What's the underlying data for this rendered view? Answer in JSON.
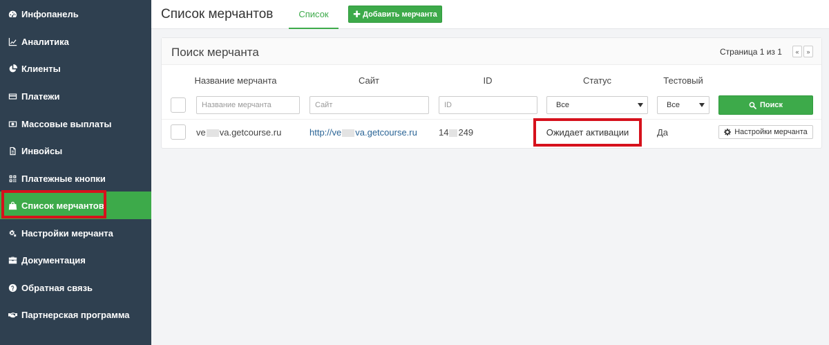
{
  "sidebar": {
    "bg_color": "#2f4050",
    "active_color": "#3daa4a",
    "items": [
      {
        "label": "Инфопанель",
        "icon": "dashboard-icon"
      },
      {
        "label": "Аналитика",
        "icon": "line-chart-icon"
      },
      {
        "label": "Клиенты",
        "icon": "pie-chart-icon"
      },
      {
        "label": "Платежи",
        "icon": "credit-card-icon"
      },
      {
        "label": "Массовые выплаты",
        "icon": "money-icon"
      },
      {
        "label": "Инвойсы",
        "icon": "document-icon"
      },
      {
        "label": "Платежные кнопки",
        "icon": "qrcode-icon"
      },
      {
        "label": "Список мерчантов",
        "icon": "shopping-bag-icon",
        "active": true
      },
      {
        "label": "Настройки мерчанта",
        "icon": "gears-icon"
      },
      {
        "label": "Документация",
        "icon": "briefcase-icon"
      },
      {
        "label": "Обратная связь",
        "icon": "question-circle-icon"
      },
      {
        "label": "Партнерская программа",
        "icon": "handshake-icon"
      }
    ]
  },
  "header": {
    "title": "Список мерчантов",
    "tab_label": "Список",
    "add_button": "Добавить мерчанта"
  },
  "panel": {
    "title": "Поиск мерчанта",
    "pager": {
      "text": "Страница 1 из 1",
      "prev": "«",
      "next": "»"
    }
  },
  "table": {
    "columns": [
      "Название мерчанта",
      "Сайт",
      "ID",
      "Статус",
      "Тестовый"
    ],
    "filters": {
      "name_placeholder": "Название мерчанта",
      "site_placeholder": "Сайт",
      "id_placeholder": "ID",
      "status_value": "Все",
      "test_value": "Все",
      "search_button": "Поиск"
    },
    "rows": [
      {
        "name_start": "ve",
        "name_end": "va.getcourse.ru",
        "site_start": "http://ve",
        "site_end": "va.getcourse.ru",
        "id_start": "14",
        "id_end": "249",
        "status": "Ожидает активации",
        "test": "Да",
        "action": "Настройки мерчанта"
      }
    ]
  },
  "highlight_color": "#d6111c"
}
